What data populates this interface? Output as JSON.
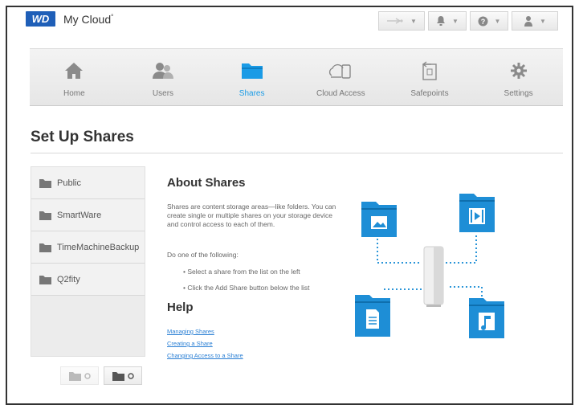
{
  "header": {
    "logo": "WD",
    "brand": "My Cloud",
    "brand_mark": "°"
  },
  "nav": {
    "items": [
      {
        "label": "Home",
        "icon": "home-icon"
      },
      {
        "label": "Users",
        "icon": "users-icon"
      },
      {
        "label": "Shares",
        "icon": "folder-icon",
        "active": true
      },
      {
        "label": "Cloud Access",
        "icon": "cloud-access-icon"
      },
      {
        "label": "Safepoints",
        "icon": "safepoint-icon"
      },
      {
        "label": "Settings",
        "icon": "gear-icon"
      }
    ]
  },
  "page": {
    "title": "Set Up Shares"
  },
  "shares": [
    {
      "label": "Public"
    },
    {
      "label": "SmartWare"
    },
    {
      "label": "TimeMachineBackup"
    },
    {
      "label": "Q2fity"
    }
  ],
  "about": {
    "title": "About Shares",
    "description": "Shares are content storage areas—like folders. You can create single or multiple shares on your storage device and control access to each of them.",
    "instruction": "Do one of the following:",
    "bullets": [
      "Select a share from the list on the left",
      "Click the Add Share button below the list"
    ]
  },
  "help": {
    "title": "Help",
    "links": [
      "Managing Shares",
      "Creating a Share",
      "Changing Access to a Share"
    ]
  },
  "colors": {
    "accent": "#1a9be6",
    "folder_blue": "#1e8ed6",
    "logo_blue": "#1f5fb8",
    "nav_bg": "#e9e9e9"
  }
}
